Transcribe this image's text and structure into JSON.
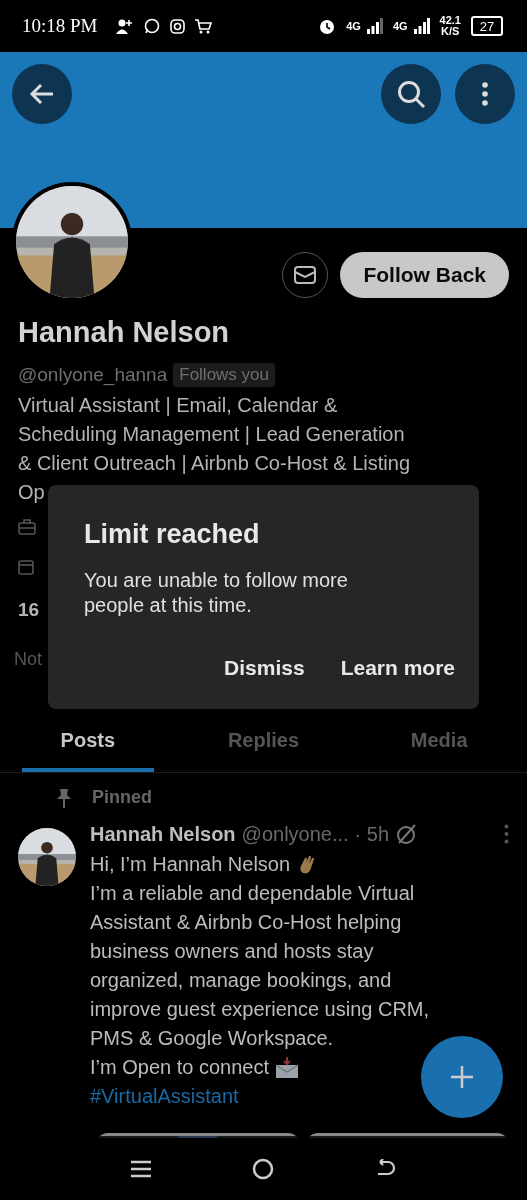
{
  "status_bar": {
    "time": "10:18 PM",
    "networks": [
      {
        "label": "4G"
      },
      {
        "label": "4G"
      }
    ],
    "speed": "42.1",
    "speed_unit": "K/S",
    "battery": "27"
  },
  "profile": {
    "name": "Hannah Nelson",
    "handle": "@onlyone_hanna",
    "follows_you": "Follows you",
    "follow_button": "Follow Back",
    "bio_lines": [
      "Virtual Assistant | Email, Calendar &",
      "Scheduling Management | Lead Generation",
      "& Client Outreach | Airbnb Co-Host & Listing",
      "Op"
    ],
    "following_count": "16",
    "followers_text": "Not"
  },
  "tabs": [
    {
      "label": "Posts",
      "selected": true
    },
    {
      "label": "Replies",
      "selected": false
    },
    {
      "label": "Media",
      "selected": false
    }
  ],
  "pinned_post": {
    "pinned_label": "Pinned",
    "author": "Hannah Nelson",
    "handle": "@onlyone...",
    "time": "· 5h",
    "greeting": "Hi, I’m Hannah Nelson",
    "body_lines": [
      "I’m a reliable and dependable Virtual",
      "Assistant & Airbnb Co-Host helping",
      "business owners and hosts stay",
      "organized, manage bookings, and",
      "improve guest experience using CRM,",
      "PMS & Google Workspace."
    ],
    "connect": "I’m Open to connect",
    "hashtag": "#VirtualAssistant"
  },
  "dialog": {
    "title": "Limit reached",
    "message": "You are unable to follow more people at this time.",
    "buttons": [
      "Dismiss",
      "Learn more"
    ]
  }
}
